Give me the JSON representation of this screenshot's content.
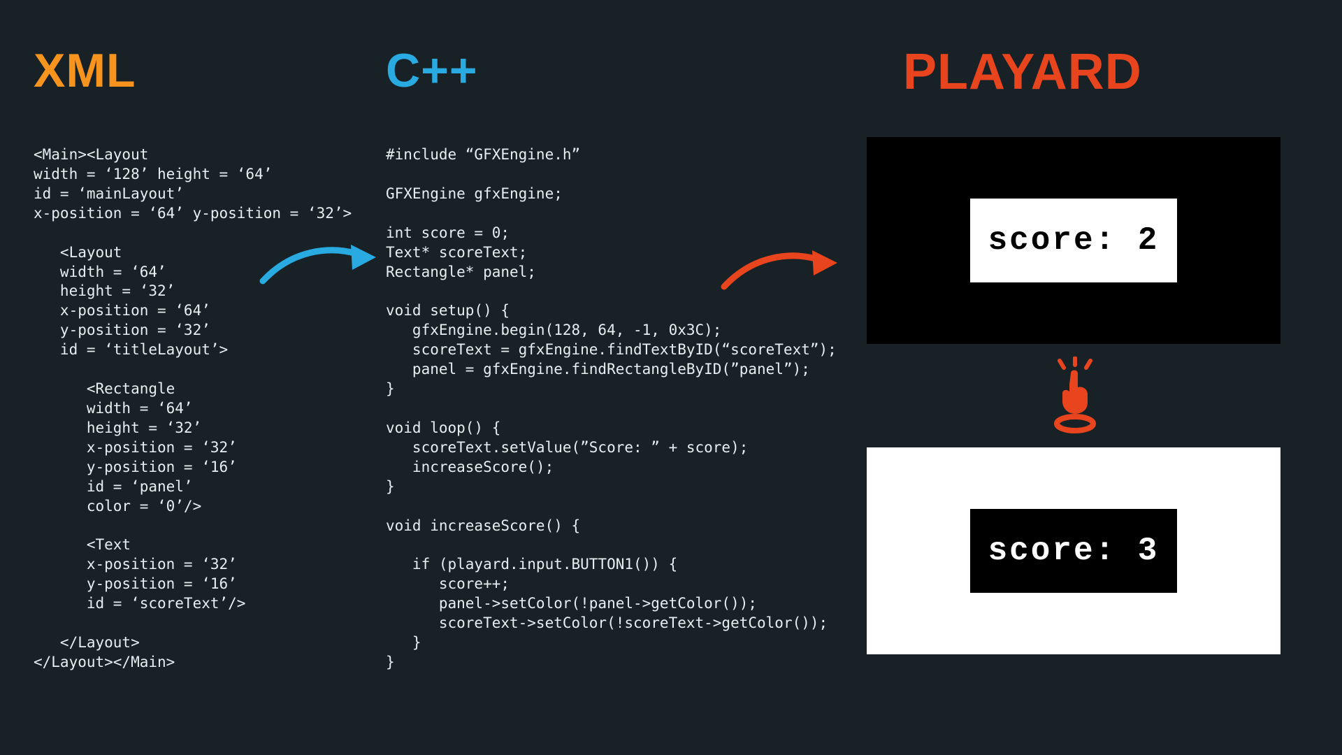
{
  "headings": {
    "xml": "XML",
    "cpp": "C++",
    "playard": "PLAYARD"
  },
  "code": {
    "xml": "<Main><Layout\nwidth = ‘128’ height = ‘64’\nid = ‘mainLayout’\nx-position = ‘64’ y-position = ‘32’>\n\n   <Layout\n   width = ‘64’\n   height = ‘32’\n   x-position = ‘64’\n   y-position = ‘32’\n   id = ‘titleLayout’>\n\n      <Rectangle\n      width = ‘64’\n      height = ‘32’\n      x-position = ‘32’\n      y-position = ‘16’\n      id = ‘panel’\n      color = ‘0’/>\n\n      <Text\n      x-position = ‘32’\n      y-position = ‘16’\n      id = ‘scoreText’/>\n\n   </Layout>\n</Layout></Main>",
    "cpp": "#include “GFXEngine.h”\n\nGFXEngine gfxEngine;\n\nint score = 0;\nText* scoreText;\nRectangle* panel;\n\nvoid setup() {\n   gfxEngine.begin(128, 64, -1, 0x3C);\n   scoreText = gfxEngine.findTextByID(“scoreText”);\n   panel = gfxEngine.findRectangleByID(”panel”);\n}\n\nvoid loop() {\n   scoreText.setValue(”Score: ” + score);\n   increaseScore();\n}\n\nvoid increaseScore() {\n\n   if (playard.input.BUTTON1()) {\n      score++;\n      panel->setColor(!panel->getColor());\n      scoreText->setColor(!scoreText->getColor());\n   }\n}"
  },
  "screens": {
    "s1": "score: 2",
    "s2": "score: 3"
  },
  "colors": {
    "bg": "#182226",
    "orange": "#f7941e",
    "blue": "#29abe2",
    "red": "#e8451e"
  }
}
